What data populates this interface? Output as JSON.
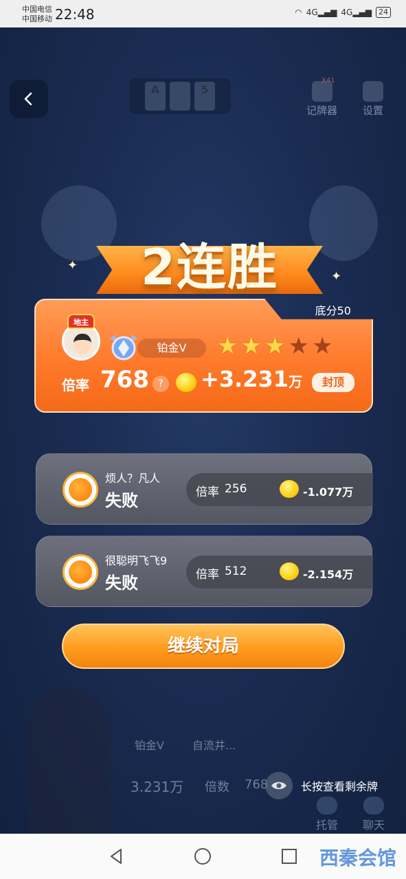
{
  "status_bar": {
    "carrier_1": "中国电信",
    "carrier_2": "中国移动",
    "time": "22:48",
    "network": "4G",
    "battery": "24"
  },
  "top": {
    "cards": [
      "A",
      "",
      "5"
    ],
    "card_counter_label": "记牌器",
    "card_counter_badge": "X41",
    "settings_label": "设置"
  },
  "banner": {
    "title": "2连胜"
  },
  "winner": {
    "base_score": "底分50",
    "role_badge": "地主",
    "rank": "铂金V",
    "stars_filled": 3,
    "stars_total": 5,
    "rate_label": "倍率",
    "rate_value": "768",
    "help_glyph": "?",
    "gain": "+3.231",
    "gain_unit": "万",
    "cap_label": "封顶"
  },
  "losers": [
    {
      "name": "烦人？凡人",
      "result": "失败",
      "rate_label": "倍率",
      "rate": "256",
      "loss": "-1.077万"
    },
    {
      "name": "很聪明飞飞9",
      "result": "失败",
      "rate_label": "倍率",
      "rate": "512",
      "loss": "-2.154万"
    }
  ],
  "continue_button": "继续对局",
  "bottom": {
    "rank_chip": "铂金V",
    "player_name": "自流井...",
    "beans": "3.231万",
    "multiplier_label": "倍数",
    "multiplier_value": "768",
    "peek_hint": "长按查看剩余牌",
    "trustee_label": "托管",
    "chat_label": "聊天"
  },
  "watermark": "西秦会馆",
  "colors": {
    "orange": "#ff7a2c",
    "gold": "#ffd84a",
    "loss_panel": "#5a5c64"
  }
}
